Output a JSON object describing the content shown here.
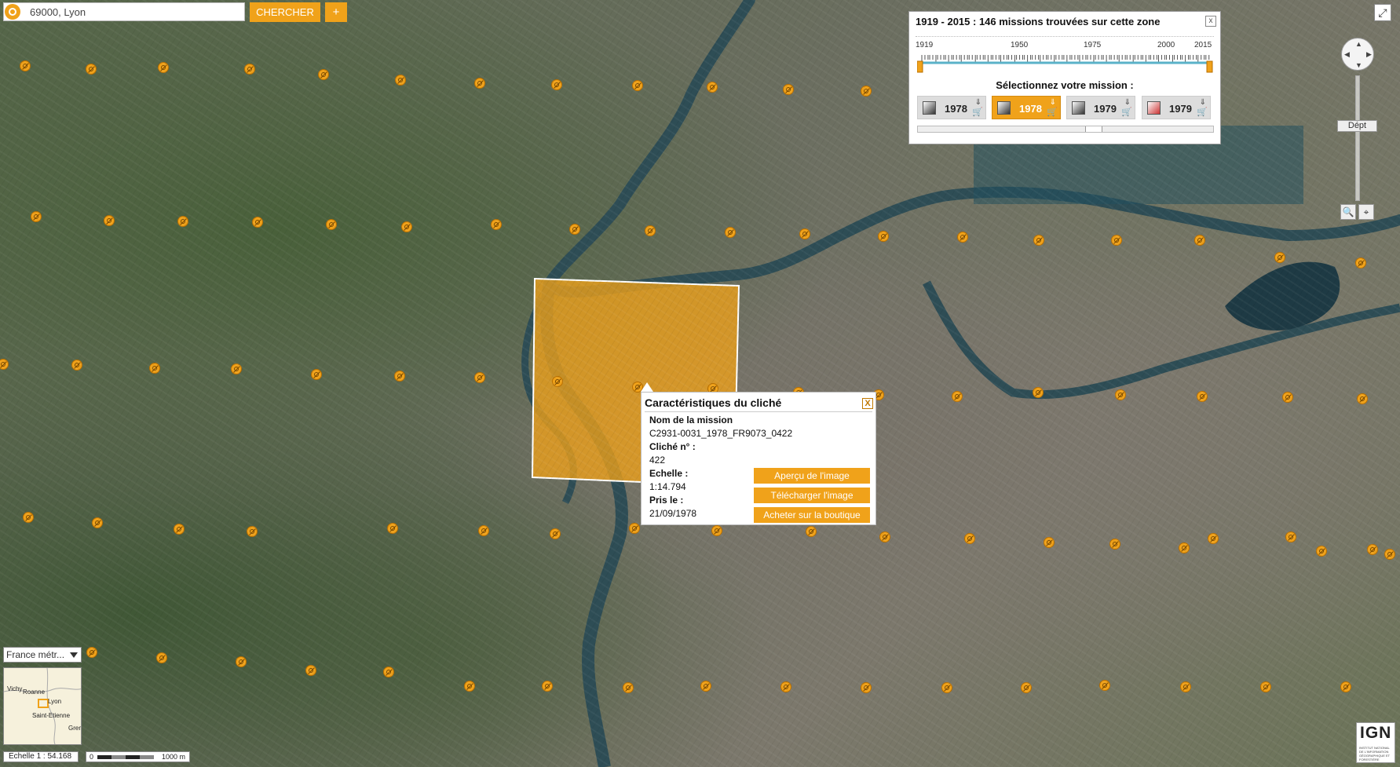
{
  "search": {
    "value": "69000, Lyon",
    "button": "CHERCHER",
    "plus": "+"
  },
  "mission_panel": {
    "title": "1919 - 2015 : 146 missions trouvées sur cette zone",
    "close": "x",
    "years": [
      "1919",
      "1950",
      "1975",
      "2000",
      "2015"
    ],
    "prompt": "Sélectionnez votre mission :",
    "missions": [
      {
        "year": "1978",
        "type": "grayscale",
        "selected": false
      },
      {
        "year": "1978",
        "type": "grayscale",
        "selected": true
      },
      {
        "year": "1979",
        "type": "grayscale",
        "selected": false
      },
      {
        "year": "1979",
        "type": "color",
        "selected": false
      }
    ]
  },
  "nav": {
    "fullscreen": "⤢",
    "zoom_label": "Dépt",
    "search_tool": "🔍",
    "locate_tool": "⌖"
  },
  "popup": {
    "title": "Caractéristiques du cliché",
    "close": "X",
    "mission_label": "Nom de la mission",
    "mission_value": "C2931-0031_1978_FR9073_0422",
    "cliche_label": "Cliché n° :",
    "cliche_value": "422",
    "scale_label": "Echelle :",
    "scale_value": "1:14.794",
    "date_label": "Pris le :",
    "date_value": "21/09/1978",
    "btn_preview": "Aperçu de l'image",
    "btn_download": "Télécharger l'image",
    "btn_buy": "Acheter sur la boutique"
  },
  "bottom": {
    "region": "France métr...",
    "overview_cities": [
      "Vichy",
      "Roanne",
      "Lyon",
      "Saint-Etienne",
      "Greno"
    ],
    "scale_text": "Echelle 1 : 54.168",
    "scale_start": "0",
    "scale_end": "1000 m"
  },
  "logo": {
    "name": "IGN",
    "tagline": "INSTITUT NATIONAL DE L'INFORMATION GÉOGRAPHIQUE ET FORESTIÈRE"
  },
  "colors": {
    "accent": "#f0a21a",
    "river": "#2e4d55"
  }
}
